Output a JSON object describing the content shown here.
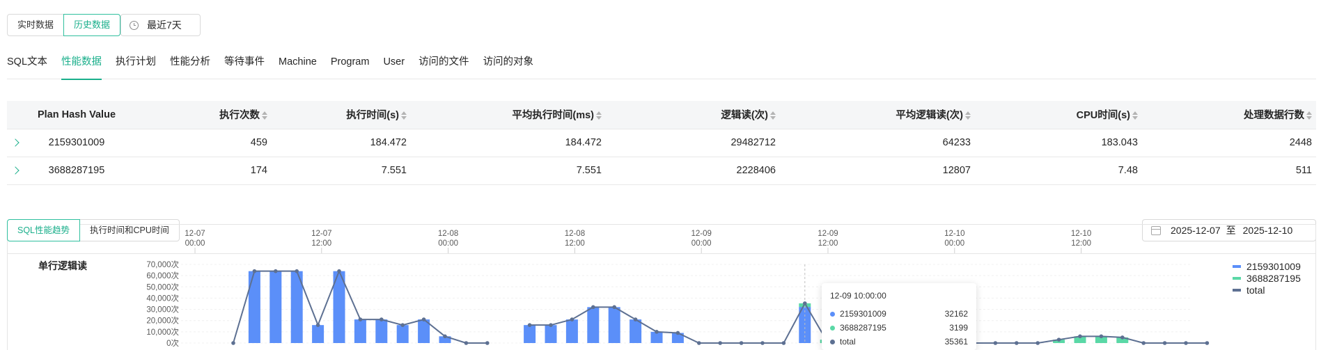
{
  "mode_toggle": {
    "realtime": "实时数据",
    "history": "历史数据"
  },
  "time_range": {
    "label": "最近7天"
  },
  "tabs": [
    "SQL文本",
    "性能数据",
    "执行计划",
    "性能分析",
    "等待事件",
    "Machine",
    "Program",
    "User",
    "访问的文件",
    "访问的对象"
  ],
  "active_tab": "性能数据",
  "table": {
    "headers": [
      "Plan Hash Value",
      "执行次数",
      "执行时间(s)",
      "平均执行时间(ms)",
      "逻辑读(次)",
      "平均逻辑读(次)",
      "CPU时间(s)",
      "处理数据行数"
    ],
    "rows": [
      [
        "2159301009",
        "459",
        "184.472",
        "184.472",
        "29482712",
        "64233",
        "183.043",
        "2448"
      ],
      [
        "3688287195",
        "174",
        "7.551",
        "7.551",
        "2228406",
        "12807",
        "7.48",
        "511"
      ]
    ]
  },
  "chart_toggle": {
    "trend": "SQL性能趋势",
    "cpu": "执行时间和CPU时间"
  },
  "date_range": {
    "start": "2025-12-07",
    "sep": "至",
    "end": "2025-12-10"
  },
  "colors": {
    "accent": "#1aaf8b",
    "series1": "#5b8ff9",
    "series2": "#5ad8a6",
    "total": "#5d7092"
  },
  "chart_data": {
    "type": "bar",
    "title": "单行逻辑读",
    "x_axis_labels": [
      [
        "12-07",
        "00:00"
      ],
      [
        "12-07",
        "12:00"
      ],
      [
        "12-08",
        "00:00"
      ],
      [
        "12-08",
        "12:00"
      ],
      [
        "12-09",
        "00:00"
      ],
      [
        "12-09",
        "12:00"
      ],
      [
        "12-10",
        "00:00"
      ],
      [
        "12-10",
        "12:00"
      ]
    ],
    "y_ticks": [
      "70,000次",
      "60,000次",
      "50,000次",
      "40,000次",
      "30,000次",
      "20,000次",
      "10,000次",
      "0次"
    ],
    "ylim": [
      0,
      70000
    ],
    "series": [
      {
        "name": "2159301009",
        "type": "bar",
        "values": [
          0,
          64000,
          64000,
          64000,
          16000,
          64000,
          21000,
          21000,
          16000,
          21000,
          6000,
          0,
          0,
          null,
          16000,
          16000,
          21000,
          32000,
          32000,
          21000,
          10000,
          9000,
          0,
          0,
          0,
          0,
          0,
          32162,
          0,
          0,
          0,
          0,
          0,
          0,
          0,
          0,
          0,
          0,
          0,
          0,
          0,
          0,
          0,
          0,
          0,
          0,
          0
        ]
      },
      {
        "name": "3688287195",
        "type": "bar",
        "values": [
          0,
          0,
          0,
          0,
          0,
          0,
          0,
          0,
          0,
          0,
          0,
          0,
          0,
          null,
          0,
          0,
          0,
          0,
          0,
          0,
          0,
          0,
          0,
          0,
          0,
          0,
          0,
          3199,
          3000,
          3000,
          3000,
          0,
          12000,
          6000,
          0,
          0,
          0,
          0,
          0,
          3000,
          6000,
          6000,
          5000,
          0,
          0,
          0,
          0
        ]
      },
      {
        "name": "total",
        "type": "line",
        "values": [
          0,
          64000,
          64000,
          64000,
          16000,
          64000,
          21000,
          21000,
          16000,
          21000,
          6000,
          0,
          0,
          null,
          16000,
          16000,
          21000,
          32000,
          32000,
          21000,
          10000,
          9000,
          0,
          0,
          0,
          0,
          0,
          35361,
          3000,
          3000,
          3000,
          0,
          12000,
          6000,
          0,
          0,
          0,
          0,
          0,
          3000,
          6000,
          6000,
          5000,
          0,
          0,
          0,
          0
        ]
      }
    ],
    "tooltip": {
      "title": "12-09 10:00:00",
      "rows": [
        {
          "name": "2159301009",
          "value": "32162"
        },
        {
          "name": "3688287195",
          "value": "3199"
        },
        {
          "name": "total",
          "value": "35361"
        }
      ]
    },
    "legend": [
      "2159301009",
      "3688287195",
      "total"
    ]
  }
}
